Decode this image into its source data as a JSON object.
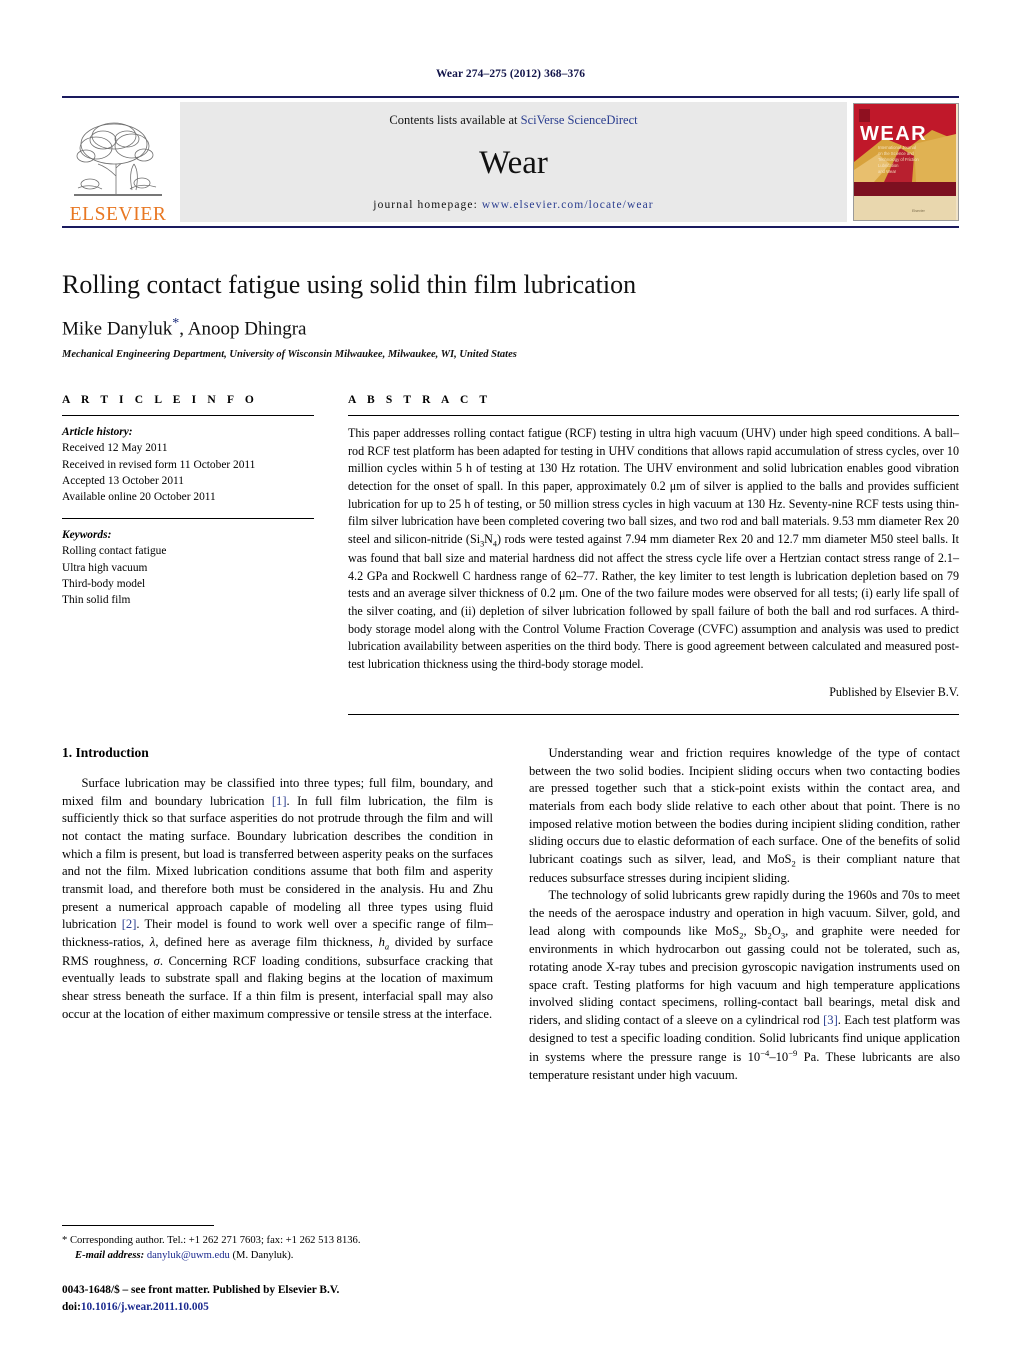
{
  "running_head": "Wear 274–275 (2012) 368–376",
  "masthead": {
    "publisher_name": "ELSEVIER",
    "contents_prefix": "Contents lists available at ",
    "contents_link": "SciVerse ScienceDirect",
    "journal_title": "Wear",
    "homepage_prefix": "journal homepage: ",
    "homepage_url": "www.elsevier.com/locate/wear",
    "cover_title": "WEAR",
    "cover_subtitle": "International Journal on the Science and Technology of Friction Lubrication and Wear",
    "cover_imprint": "Elsevier"
  },
  "title": "Rolling contact fatigue using solid thin film lubrication",
  "authors": "Mike Danyluk",
  "authors_rest": ", Anoop Dhingra",
  "corresponding_marker": "*",
  "affiliation": "Mechanical Engineering Department, University of Wisconsin Milwaukee, Milwaukee, WI, United States",
  "article_info": {
    "heading": "A R T I C L E    I N F O",
    "history_label": "Article history:",
    "history": [
      "Received 12 May 2011",
      "Received in revised form 11 October 2011",
      "Accepted 13 October 2011",
      "Available online 20 October 2011"
    ],
    "keywords_label": "Keywords:",
    "keywords": [
      "Rolling contact fatigue",
      "Ultra high vacuum",
      "Third-body model",
      "Thin solid film"
    ]
  },
  "abstract": {
    "heading": "A B S T R A C T",
    "text_part1": "This paper addresses rolling contact fatigue (RCF) testing in ultra high vacuum (UHV) under high speed conditions. A ball–rod RCF test platform has been adapted for testing in UHV conditions that allows rapid accumulation of stress cycles, over 10 million cycles within 5 h of testing at 130 Hz rotation. The UHV environment and solid lubrication enables good vibration detection for the onset of spall. In this paper, approximately 0.2 ",
    "mu1": "μ",
    "text_part2": "m of silver is applied to the balls and provides sufficient lubrication for up to 25 h of testing, or 50 million stress cycles in high vacuum at 130 Hz. Seventy-nine RCF tests using thin-film silver lubrication have been completed covering two ball sizes, and two rod and ball materials. 9.53 mm diameter Rex 20 steel and silicon-nitride (Si",
    "sub3": "3",
    "text_part3": "N",
    "sub4": "4",
    "text_part4": ") rods were tested against 7.94 mm diameter Rex 20 and 12.7 mm diameter M50 steel balls. It was found that ball size and material hardness did not affect the stress cycle life over a Hertzian contact stress range of 2.1–4.2 GPa and Rockwell C hardness range of 62–77. Rather, the key limiter to test length is lubrication depletion based on 79 tests and an average silver thickness of 0.2 ",
    "mu2": "μ",
    "text_part5": "m. One of the two failure modes were observed for all tests; (i) early life spall of the silver coating, and (ii) depletion of silver lubrication followed by spall failure of both the ball and rod surfaces. A third-body storage model along with the Control Volume Fraction Coverage (CVFC) assumption and analysis was used to predict lubrication availability between asperities on the third body. There is good agreement between calculated and measured post-test lubrication thickness using the third-body storage model.",
    "published_by": "Published by Elsevier B.V."
  },
  "introduction": {
    "heading": "1.  Introduction",
    "left_p1_a": "Surface lubrication may be classified into three types; full film, boundary, and mixed film and boundary lubrication ",
    "left_p1_cite1": "[1]",
    "left_p1_b": ". In full film lubrication, the film is sufficiently thick so that surface asperities do not protrude through the film and will not contact the mating surface. Boundary lubrication describes the condition in which a film is present, but load is transferred between asperity peaks on the surfaces and not the film. Mixed lubrication conditions assume that both film and asperity transmit load, and therefore both must be considered in the analysis. Hu and Zhu present a numerical approach capable of modeling all three types using fluid lubrication ",
    "left_p1_cite2": "[2]",
    "left_p1_c": ". Their model is found to work well over a specific range of film–thickness-ratios, ",
    "lambda": "λ",
    "left_p1_d": ", defined here as average film thickness, ",
    "h_a": "h",
    "h_a_sub": "a",
    "left_p1_e": " divided by surface RMS roughness, ",
    "sigma": "σ",
    "left_p1_f": ". Concerning RCF loading conditions, subsurface cracking that eventually leads to substrate spall and flaking begins at the location of maximum shear stress beneath the surface. If a thin film is present, interfacial spall may also occur at the location of either maximum compressive or tensile stress at the interface.",
    "right_p1": "Understanding wear and friction requires knowledge of the type of contact between the two solid bodies. Incipient sliding occurs when two contacting bodies are pressed together such that a stick-point exists within the contact area, and materials from each body slide relative to each other about that point. There is no imposed relative motion between the bodies during incipient sliding condition, rather sliding occurs due to elastic deformation of each surface. One of the benefits of solid lubricant coatings such as silver, lead, and MoS",
    "right_p1_sub": "2",
    "right_p1_b": " is their compliant nature that reduces subsurface stresses during incipient sliding.",
    "right_p2_a": "The technology of solid lubricants grew rapidly during the 1960s and 70s to meet the needs of the aerospace industry and operation in high vacuum. Silver, gold, and lead along with compounds like MoS",
    "right_p2_sub1": "2",
    "right_p2_b": ", Sb",
    "right_p2_sub2": "2",
    "right_p2_c": "O",
    "right_p2_sub3": "3",
    "right_p2_d": ", and graphite were needed for environments in which hydrocarbon out gassing could not be tolerated, such as, rotating anode X-ray tubes and precision gyroscopic navigation instruments used on space craft. Testing platforms for high vacuum and high temperature applications involved sliding contact specimens, rolling-contact ball bearings, metal disk and riders, and sliding contact of a sleeve on a cylindrical rod ",
    "right_p2_cite": "[3]",
    "right_p2_e": ". Each test platform was designed to test a specific loading condition. Solid lubricants find unique application in systems where the pressure range is 10",
    "sup_neg4": "−4",
    "right_p2_f": "–10",
    "sup_neg9": "−9",
    "right_p2_g": " Pa. These lubricants are also temperature resistant under high vacuum."
  },
  "footnote": {
    "marker": "*",
    "corresponding": " Corresponding author. Tel.: +1 262 271 7603; fax: +1 262 513 8136.",
    "email_label": "E-mail address:",
    "email": "danyluk@uwm.edu",
    "email_owner": "(M. Danyluk)."
  },
  "imprint": {
    "line1": "0043-1648/$ – see front matter. Published by Elsevier B.V.",
    "doi_label": "doi:",
    "doi": "10.1016/j.wear.2011.10.005"
  },
  "colors": {
    "link": "#2a3d8f",
    "elsevier_orange": "#e87722",
    "rule_navy": "#1a1a5e",
    "band_gray": "#e9e9e9"
  }
}
